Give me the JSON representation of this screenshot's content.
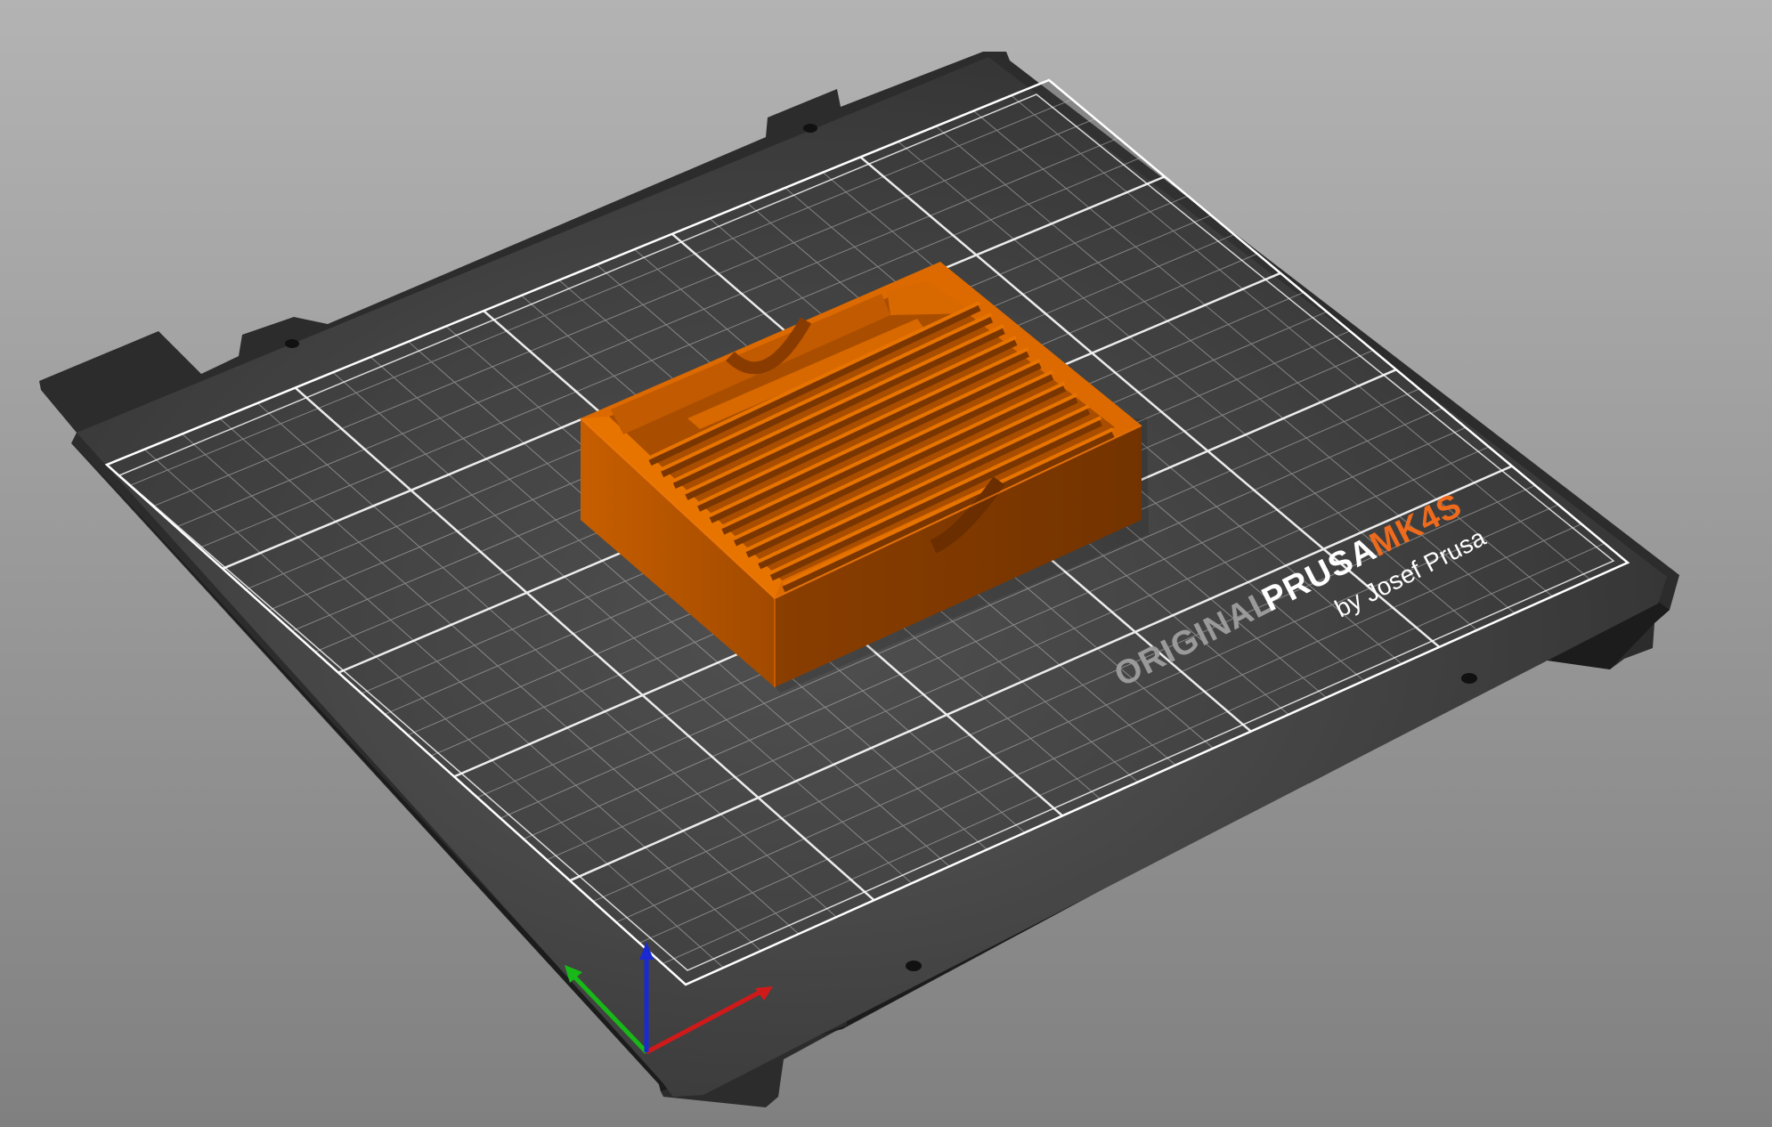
{
  "viewport": {
    "label": "3D view"
  },
  "bed": {
    "brand_original": "ORIGINAL",
    "brand_prusa": "PRUSA",
    "brand_model": "MK4S",
    "brand_byline": "by Josef Prusa",
    "colors": {
      "sheet": "#3a3a3a",
      "grid": "#ffffff",
      "model_accent": "#f06a10",
      "brand_model": "#ee6a1c"
    }
  },
  "model": {
    "name": "sd-card-holder-model",
    "color": "#d26500"
  },
  "axes": {
    "x_color": "#d01a1a",
    "y_color": "#18b818",
    "z_color": "#1a2ad0"
  }
}
